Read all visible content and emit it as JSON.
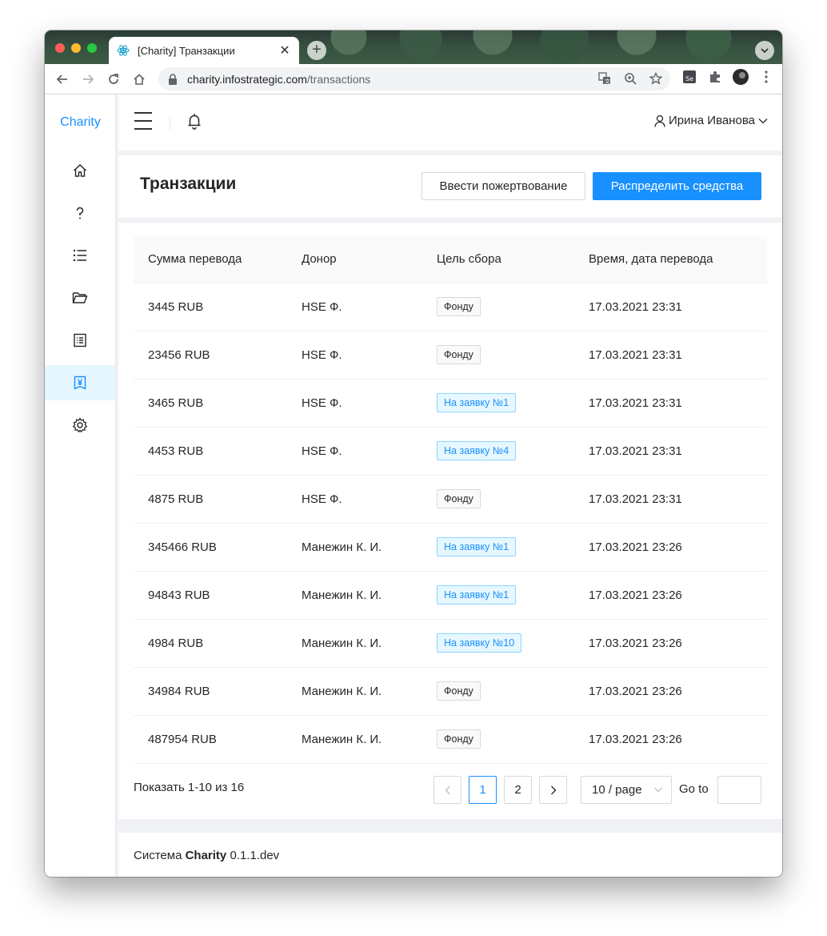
{
  "browser": {
    "tab_title": "[Charity] Транзакции",
    "tab_close": "✕",
    "new_tab": "+",
    "url_host": "charity.infostrategic.com",
    "url_path": "/transactions"
  },
  "app": {
    "logo": "Charity",
    "user_name": "Ирина Иванова",
    "sidebar_icons": [
      "home-icon",
      "question-icon",
      "list-icon",
      "folder-icon",
      "document-list-icon",
      "money-icon",
      "gear-icon"
    ],
    "active_sidebar_index": 5
  },
  "page": {
    "title": "Транзакции",
    "btn_donation": "Ввести пожертвование",
    "btn_distribute": "Распределить средства"
  },
  "table": {
    "headers": [
      "Сумма перевода",
      "Донор",
      "Цель сбора",
      "Время, дата перевода"
    ],
    "rows": [
      {
        "amount": "3445 RUB",
        "donor": "HSE Ф.",
        "goal": "Фонду",
        "goal_type": "default",
        "time": "17.03.2021 23:31"
      },
      {
        "amount": "23456 RUB",
        "donor": "HSE Ф.",
        "goal": "Фонду",
        "goal_type": "default",
        "time": "17.03.2021 23:31"
      },
      {
        "amount": "3465 RUB",
        "donor": "HSE Ф.",
        "goal": "На заявку №1",
        "goal_type": "blue",
        "time": "17.03.2021 23:31"
      },
      {
        "amount": "4453 RUB",
        "donor": "HSE Ф.",
        "goal": "На заявку №4",
        "goal_type": "blue",
        "time": "17.03.2021 23:31"
      },
      {
        "amount": "4875 RUB",
        "donor": "HSE Ф.",
        "goal": "Фонду",
        "goal_type": "default",
        "time": "17.03.2021 23:31"
      },
      {
        "amount": "345466 RUB",
        "donor": "Манежин К. И.",
        "goal": "На заявку №1",
        "goal_type": "blue",
        "time": "17.03.2021 23:26"
      },
      {
        "amount": "94843 RUB",
        "donor": "Манежин К. И.",
        "goal": "На заявку №1",
        "goal_type": "blue",
        "time": "17.03.2021 23:26"
      },
      {
        "amount": "4984 RUB",
        "donor": "Манежин К. И.",
        "goal": "На заявку №10",
        "goal_type": "blue",
        "time": "17.03.2021 23:26"
      },
      {
        "amount": "34984 RUB",
        "donor": "Манежин К. И.",
        "goal": "Фонду",
        "goal_type": "default",
        "time": "17.03.2021 23:26"
      },
      {
        "amount": "487954 RUB",
        "donor": "Манежин К. И.",
        "goal": "Фонду",
        "goal_type": "default",
        "time": "17.03.2021 23:26"
      }
    ]
  },
  "pagination": {
    "info": "Показать 1-10 из 16",
    "prev": "<",
    "pages": [
      "1",
      "2"
    ],
    "current": "1",
    "next": ">",
    "page_size": "10 / page",
    "goto_label": "Go to"
  },
  "footer": {
    "prefix": "Система",
    "brand": "Charity",
    "version": "0.1.1.dev"
  },
  "colors": {
    "primary": "#1890ff",
    "tag_blue_bg": "#e6f7ff",
    "tag_blue_border": "#91d5ff"
  }
}
